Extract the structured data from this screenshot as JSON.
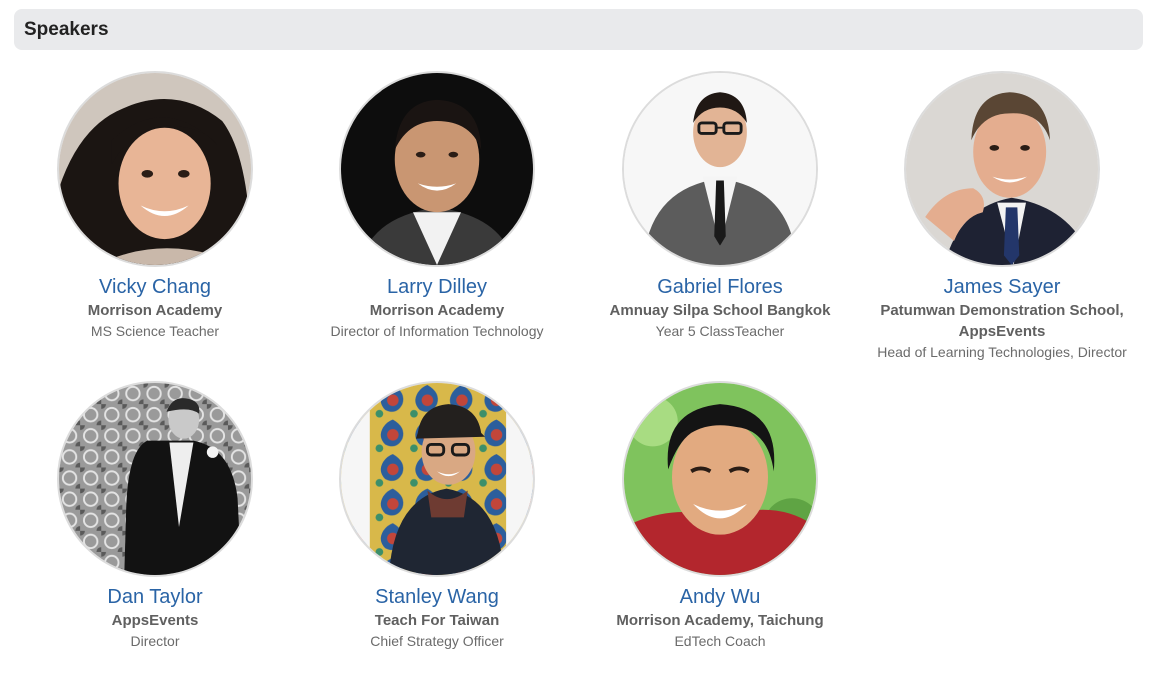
{
  "section": {
    "title": "Speakers"
  },
  "speakers": [
    {
      "name": "Vicky Chang",
      "org": "Morrison Academy",
      "role": "MS Science Teacher",
      "photo": "speaker-photo-woman-smiling-dark-curly-hair"
    },
    {
      "name": "Larry Dilley",
      "org": "Morrison Academy",
      "role": "Director of Information Technology",
      "photo": "speaker-photo-man-smiling-dark-background"
    },
    {
      "name": "Gabriel Flores",
      "org": "Amnuay Silpa School Bangkok",
      "role": "Year 5 ClassTeacher",
      "photo": "speaker-photo-man-glasses-suit-tie"
    },
    {
      "name": "James Sayer",
      "org_lines": [
        "Patumwan Demonstration School,",
        "AppsEvents"
      ],
      "role": "Head of Learning Technologies, Director",
      "photo": "speaker-photo-man-hand-on-chin-suit"
    },
    {
      "name": "Dan Taylor",
      "org": "AppsEvents",
      "role": "Director",
      "photo": "speaker-photo-man-black-white-suit"
    },
    {
      "name": "Stanley Wang",
      "org": "Teach For Taiwan",
      "role": "Chief Strategy Officer",
      "photo": "speaker-photo-man-glasses-cap-patterned-wall"
    },
    {
      "name": "Andy Wu",
      "org": "Morrison Academy, Taichung",
      "role": "EdTech Coach",
      "photo": "speaker-photo-man-smiling-red-shirt"
    }
  ],
  "colors": {
    "name_link": "#2a64a6",
    "org_text": "#606060",
    "role_text": "#6b6b6b",
    "header_bg": "#e9eaec"
  }
}
